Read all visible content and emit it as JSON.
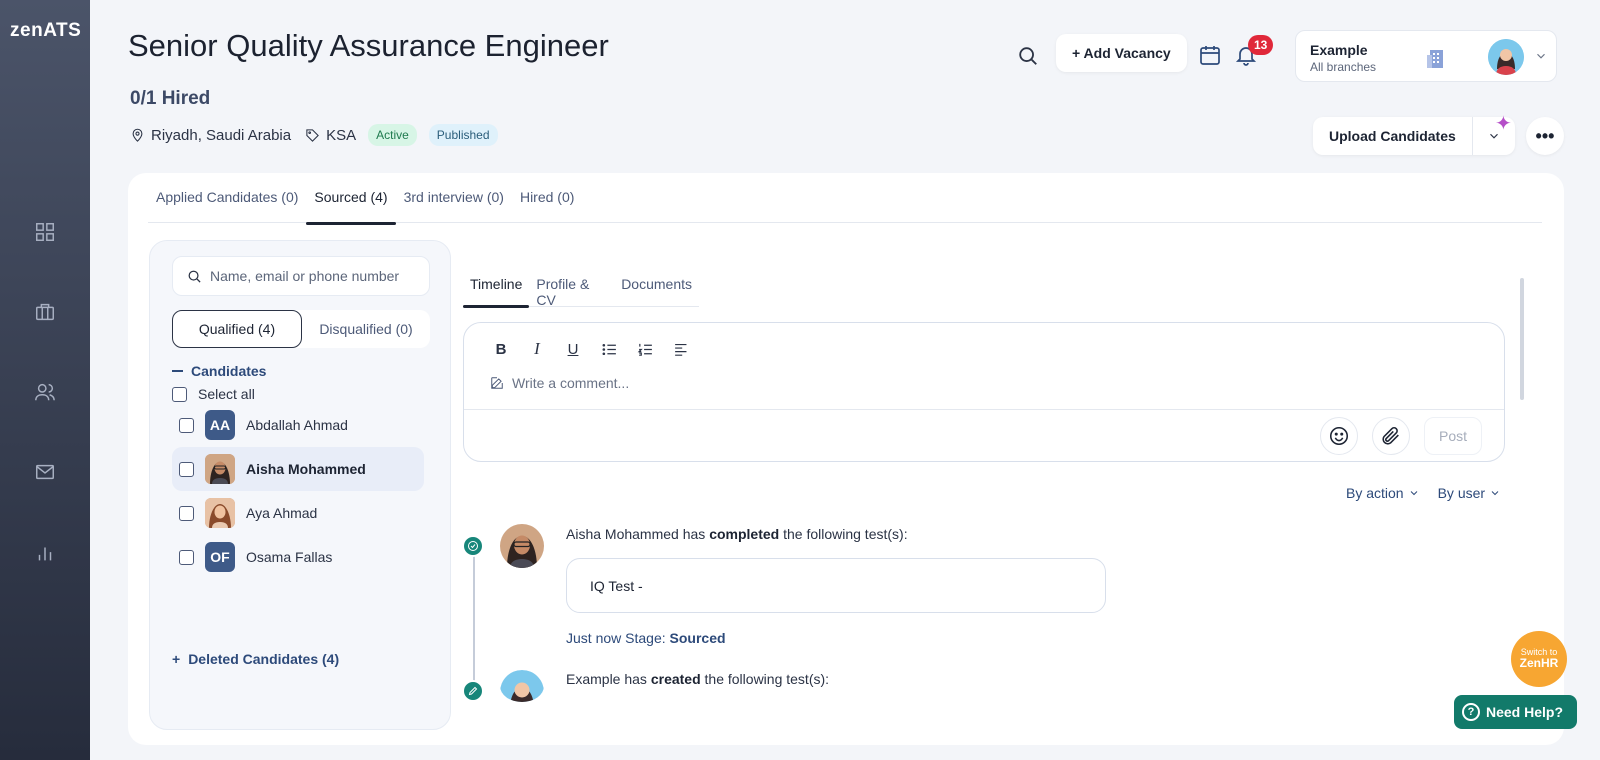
{
  "app": {
    "logo_part1": "zen",
    "logo_part2": "ATS"
  },
  "sidebar": {
    "items": [
      {
        "icon": "dashboard-icon"
      },
      {
        "icon": "briefcase-icon"
      },
      {
        "icon": "users-icon"
      },
      {
        "icon": "mail-icon"
      },
      {
        "icon": "analytics-icon"
      }
    ]
  },
  "header": {
    "title": "Senior Quality Assurance Engineer",
    "hired": "0/1 Hired",
    "location": "Riyadh, Saudi Arabia",
    "tag": "KSA",
    "status": "Active",
    "publish_state": "Published",
    "add_vacancy": "+ Add Vacancy",
    "notification_count": "13",
    "company_name": "Example",
    "company_branch": "All branches",
    "upload_label": "Upload Candidates",
    "more_label": "•••",
    "sparkle": "✦"
  },
  "tabs": [
    {
      "label": "Applied Candidates (0)"
    },
    {
      "label": "Sourced (4)"
    },
    {
      "label": "3rd interview (0)"
    },
    {
      "label": "Hired (0)"
    }
  ],
  "candidates_panel": {
    "search_placeholder": "Name, email or phone number",
    "qualified": "Qualified (4)",
    "disqualified": "Disqualified (0)",
    "section": "Candidates",
    "select_all": "Select all",
    "list": [
      {
        "initials": "AA",
        "name": "Abdallah Ahmad",
        "photo": false
      },
      {
        "initials": "",
        "name": "Aisha Mohammed",
        "photo": true
      },
      {
        "initials": "",
        "name": "Aya Ahmad",
        "photo": true
      },
      {
        "initials": "OF",
        "name": "Osama Fallas",
        "photo": false
      }
    ],
    "deleted": "Deleted Candidates (4)",
    "deleted_icon": "+"
  },
  "detail": {
    "sub_tabs": [
      {
        "label": "Timeline"
      },
      {
        "label": "Profile & CV"
      },
      {
        "label": "Documents"
      }
    ],
    "comment_placeholder": "Write a comment...",
    "toolbar": {
      "bold": "B",
      "italic": "I",
      "underline": "U"
    },
    "post": "Post",
    "filter_action": "By action",
    "filter_user": "By user",
    "timeline": [
      {
        "actor": "Aisha Mohammed has ",
        "verb": "completed",
        "rest": " the following test(s):",
        "test": "IQ Test -",
        "time": "Just now",
        "stage_label": " Stage: ",
        "stage": "Sourced"
      },
      {
        "actor": "Example has ",
        "verb": "created",
        "rest": " the following test(s):"
      }
    ]
  },
  "floating": {
    "switch_line1": "Switch to",
    "switch_line2": "ZenHR",
    "help": "Need Help?",
    "help_icon": "?"
  }
}
